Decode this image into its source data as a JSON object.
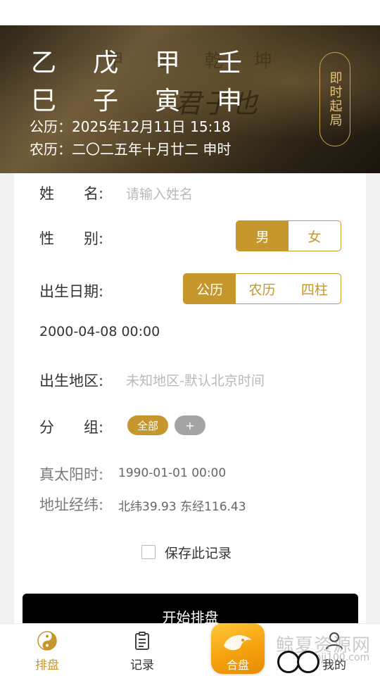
{
  "header": {
    "bazi_top": [
      "乙",
      "戊",
      "甲",
      "壬"
    ],
    "bazi_bottom": [
      "巳",
      "子",
      "寅",
      "申"
    ],
    "solar_line": "公历：2025年12月11日 15:18",
    "lunar_line": "农历：二〇二五年十月廿二 申时",
    "instant_button": "即时起局",
    "background_calligraphy": "君子也"
  },
  "form": {
    "name_label": "姓　　名:",
    "name_placeholder": "请输入姓名",
    "gender_label": "性　　别:",
    "gender_options": [
      "男",
      "女"
    ],
    "gender_selected": "男",
    "birth_label": "出生日期:",
    "calendar_options": [
      "公历",
      "农历",
      "四柱"
    ],
    "calendar_selected": "公历",
    "birth_value": "2000-04-08 00:00",
    "region_label": "出生地区:",
    "region_placeholder": "未知地区-默认北京时间",
    "group_label": "分　　组:",
    "group_chip": "全部",
    "group_add": "+",
    "true_solar_label": "真太阳时:",
    "true_solar_value": "1990-01-01 00:00",
    "coords_label": "地址经纬:",
    "coords_value": "北纬39.93 东经116.43",
    "save_label": "保存此记录",
    "start_button": "开始排盘"
  },
  "tabbar": {
    "items": [
      {
        "label": "排盘",
        "icon": "yin-yang-icon",
        "active": true
      },
      {
        "label": "记录",
        "icon": "clipboard-icon",
        "active": false
      },
      {
        "label": "合盘",
        "icon": "merge-icon",
        "active": false
      },
      {
        "label": "我的",
        "icon": "user-icon",
        "active": false
      }
    ]
  },
  "watermark": {
    "title": "鲸夏资源网",
    "sub": "danji100.com"
  },
  "colors": {
    "accent": "#c6972d",
    "banner_dark": "#2e2518",
    "start_button": "#000000"
  }
}
